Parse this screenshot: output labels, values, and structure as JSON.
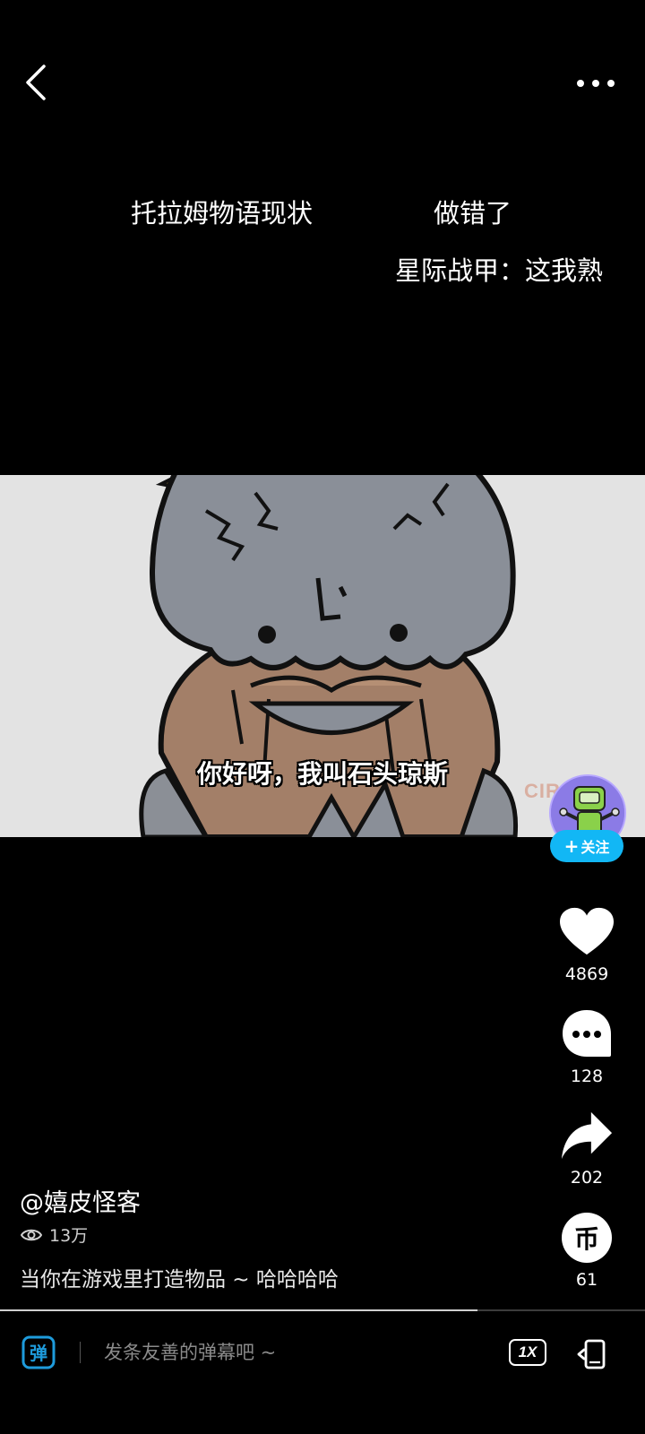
{
  "top_bar": {
    "back_icon": "chevron-left-icon",
    "more_icon": "more-horizontal-icon"
  },
  "video_captions": {
    "line1_left": "托拉姆物语现状",
    "line1_right": "做错了",
    "line2": "星际战甲：这我熟"
  },
  "video": {
    "subtitle": "你好呀，我叫石头琼斯",
    "watermark": "CIRC",
    "progress": 0.74
  },
  "creator": {
    "avatar_icon": "robot-avatar-icon",
    "follow_label": "关注"
  },
  "actions": {
    "like_count": "4869",
    "comment_count": "128",
    "share_count": "202",
    "coin_count": "61",
    "coin_glyph": "币"
  },
  "info": {
    "author": "@嬉皮怪客",
    "views": "13万",
    "description": "当你在游戏里打造物品 ~ 哈哈哈哈"
  },
  "bottom_bar": {
    "danmaku_glyph": "弹",
    "danmaku_placeholder": "发条友善的弹幕吧 ~",
    "speed_label": "1X"
  },
  "colors": {
    "background": "#000000",
    "follow_button": "#12b7f5",
    "danmaku_icon": "#1e9bdb"
  }
}
